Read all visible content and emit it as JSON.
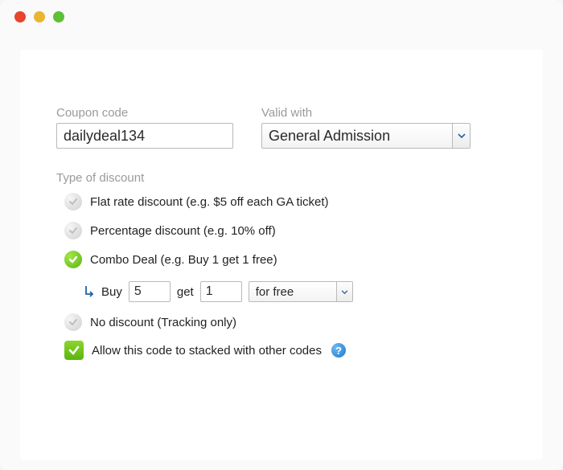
{
  "coupon": {
    "label": "Coupon code",
    "value": "dailydeal134"
  },
  "validWith": {
    "label": "Valid with",
    "value": "General Admission"
  },
  "discountSection": {
    "label": "Type of discount",
    "options": {
      "flat": "Flat rate discount (e.g. $5 off each GA ticket)",
      "percent": "Percentage discount (e.g. 10% off)",
      "combo": "Combo Deal (e.g. Buy 1 get 1 free)",
      "none": "No discount (Tracking only)"
    }
  },
  "combo": {
    "buyLabel": "Buy",
    "buyValue": "5",
    "getLabel": "get",
    "getValue": "1",
    "modeValue": "for free"
  },
  "stack": {
    "label": "Allow this code to stacked with other codes",
    "help": "?"
  }
}
